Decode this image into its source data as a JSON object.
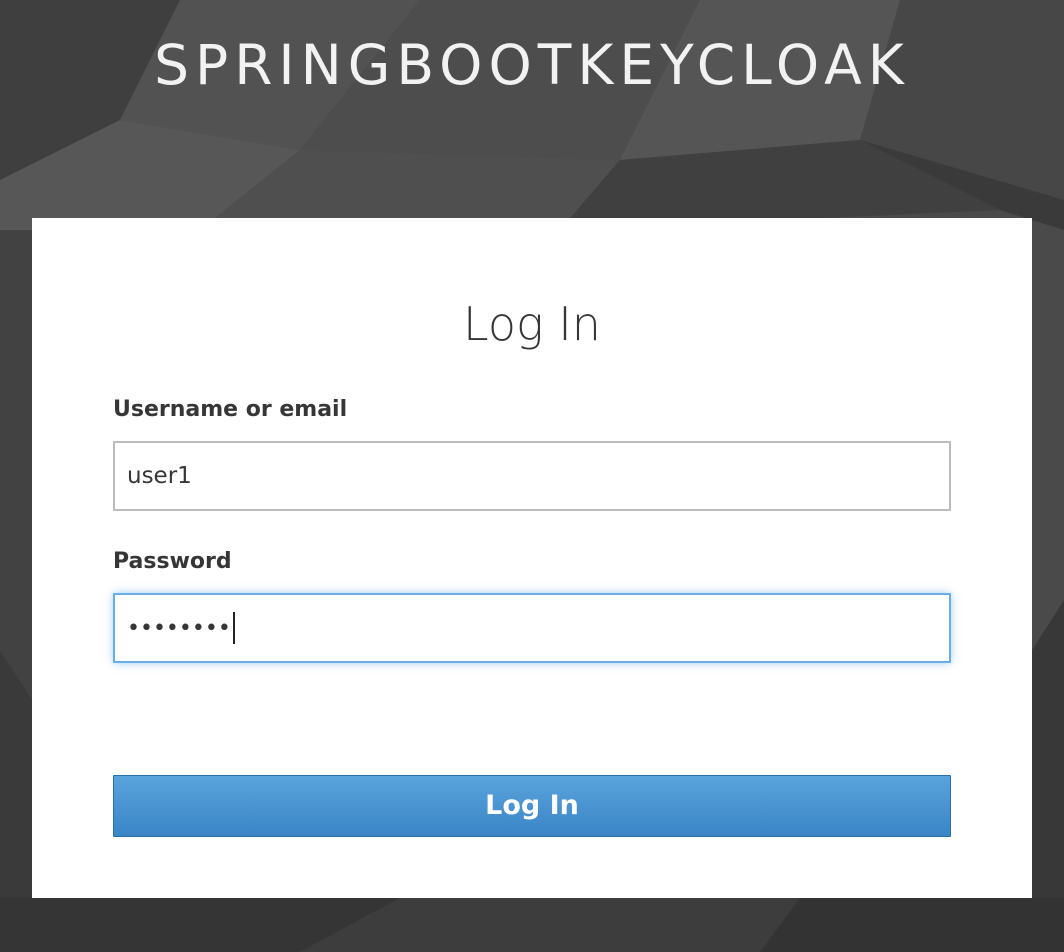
{
  "realm": {
    "title": "SPRINGBOOTKEYCLOAK"
  },
  "form": {
    "title": "Log In",
    "username_label": "Username or email",
    "username_value": "user1",
    "password_label": "Password",
    "password_value": "••••••••",
    "submit_label": "Log In"
  },
  "colors": {
    "background": "#454545",
    "card": "#ffffff",
    "button": "#3f8ccd",
    "focus_border": "#66afe9",
    "text": "#363636"
  }
}
